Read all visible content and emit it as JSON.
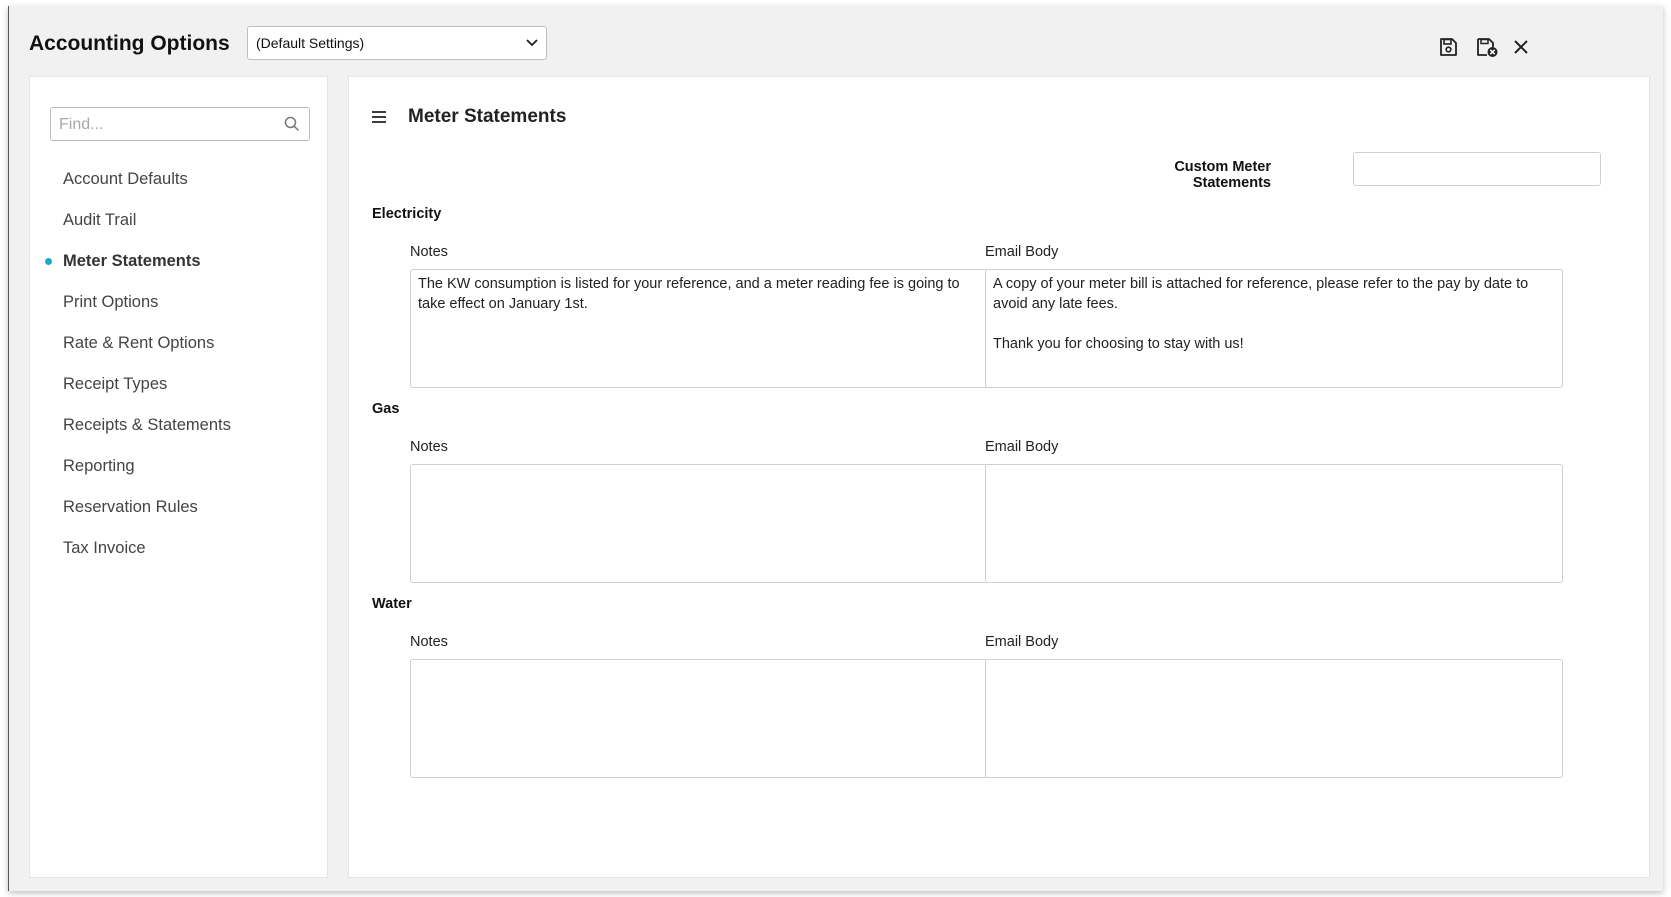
{
  "window": {
    "title": "Accounting Options",
    "profile_select": "(Default Settings)"
  },
  "toolbar": {
    "save_icon": "save-icon",
    "save_close_icon": "save-close-icon",
    "close_icon": "close-icon"
  },
  "sidebar": {
    "search_placeholder": "Find...",
    "items": [
      {
        "label": "Account Defaults"
      },
      {
        "label": "Audit Trail"
      },
      {
        "label": "Meter Statements",
        "active": true
      },
      {
        "label": "Print Options"
      },
      {
        "label": "Rate & Rent Options"
      },
      {
        "label": "Receipt Types"
      },
      {
        "label": "Receipts & Statements"
      },
      {
        "label": "Reporting"
      },
      {
        "label": "Reservation Rules"
      },
      {
        "label": "Tax Invoice"
      }
    ]
  },
  "main": {
    "title": "Meter Statements",
    "custom_label": "Custom Meter Statements",
    "custom_value": "",
    "sections": [
      {
        "title": "Electricity",
        "notes_label": "Notes",
        "notes_value": "The KW consumption is listed for your reference, and a meter reading fee is going to take effect on January 1st.",
        "email_label": "Email Body",
        "email_value": "A copy of your meter bill is attached for reference, please refer to the pay by date to avoid any late fees.\n\nThank you for choosing to stay with us!"
      },
      {
        "title": "Gas",
        "notes_label": "Notes",
        "notes_value": "",
        "email_label": "Email Body",
        "email_value": ""
      },
      {
        "title": "Water",
        "notes_label": "Notes",
        "notes_value": "",
        "email_label": "Email Body",
        "email_value": ""
      }
    ]
  },
  "colors": {
    "accent": "#1aa8c9",
    "close_badge": "#222222"
  }
}
